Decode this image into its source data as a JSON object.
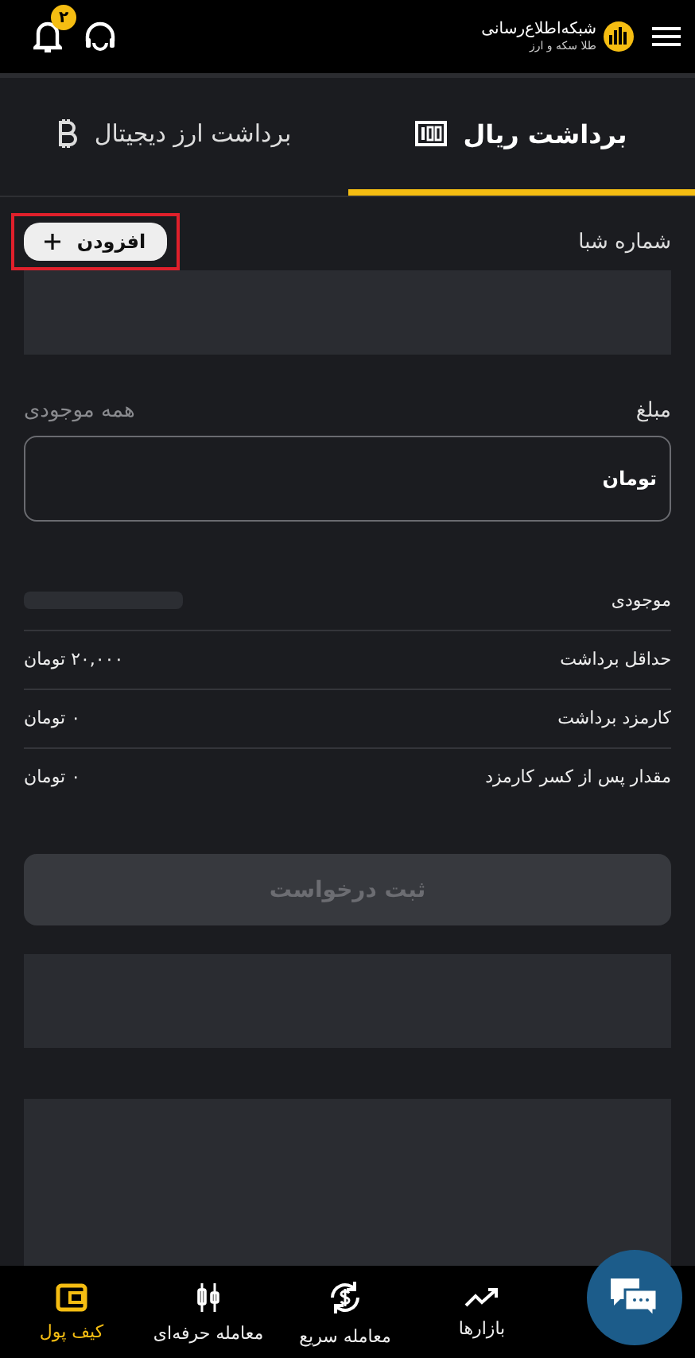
{
  "header": {
    "logo": {
      "title": "شبکه‌اطلاع‌رسانی",
      "subtitle": "طلا سکه و ارز"
    },
    "notifications": {
      "count": "۲"
    }
  },
  "tabs": [
    {
      "label": "برداشت ریال",
      "kind": "cash",
      "selected": true
    },
    {
      "label": "برداشت ارز دیجیتال",
      "kind": "bitcoin",
      "selected": false
    }
  ],
  "iban": {
    "label": "شماره شبا",
    "add_button": "افزودن"
  },
  "amount": {
    "label": "مبلغ",
    "all_balance": "همه موجودی",
    "unit": "تومان"
  },
  "details": [
    {
      "label": "موجودی",
      "kind": "loading"
    },
    {
      "label": "حداقل برداشت",
      "kind": "text",
      "value": "۲۰,۰۰۰ تومان"
    },
    {
      "label": "کارمزد برداشت",
      "kind": "text",
      "value": "۰ تومان"
    },
    {
      "label": "مقدار پس از کسر کارمزد",
      "kind": "text",
      "value": "۰ تومان"
    }
  ],
  "submit": {
    "label": "ثبت درخواست",
    "disabled": true
  },
  "bottom_nav": [
    {
      "label": "بازارها",
      "kind": "trend",
      "selected": false
    },
    {
      "label": "معامله سریع",
      "kind": "exchange",
      "selected": false
    },
    {
      "label": "معامله حرفه‌ای",
      "kind": "candles",
      "selected": false
    },
    {
      "label": "کیف پول",
      "kind": "wallet",
      "selected": true
    }
  ]
}
